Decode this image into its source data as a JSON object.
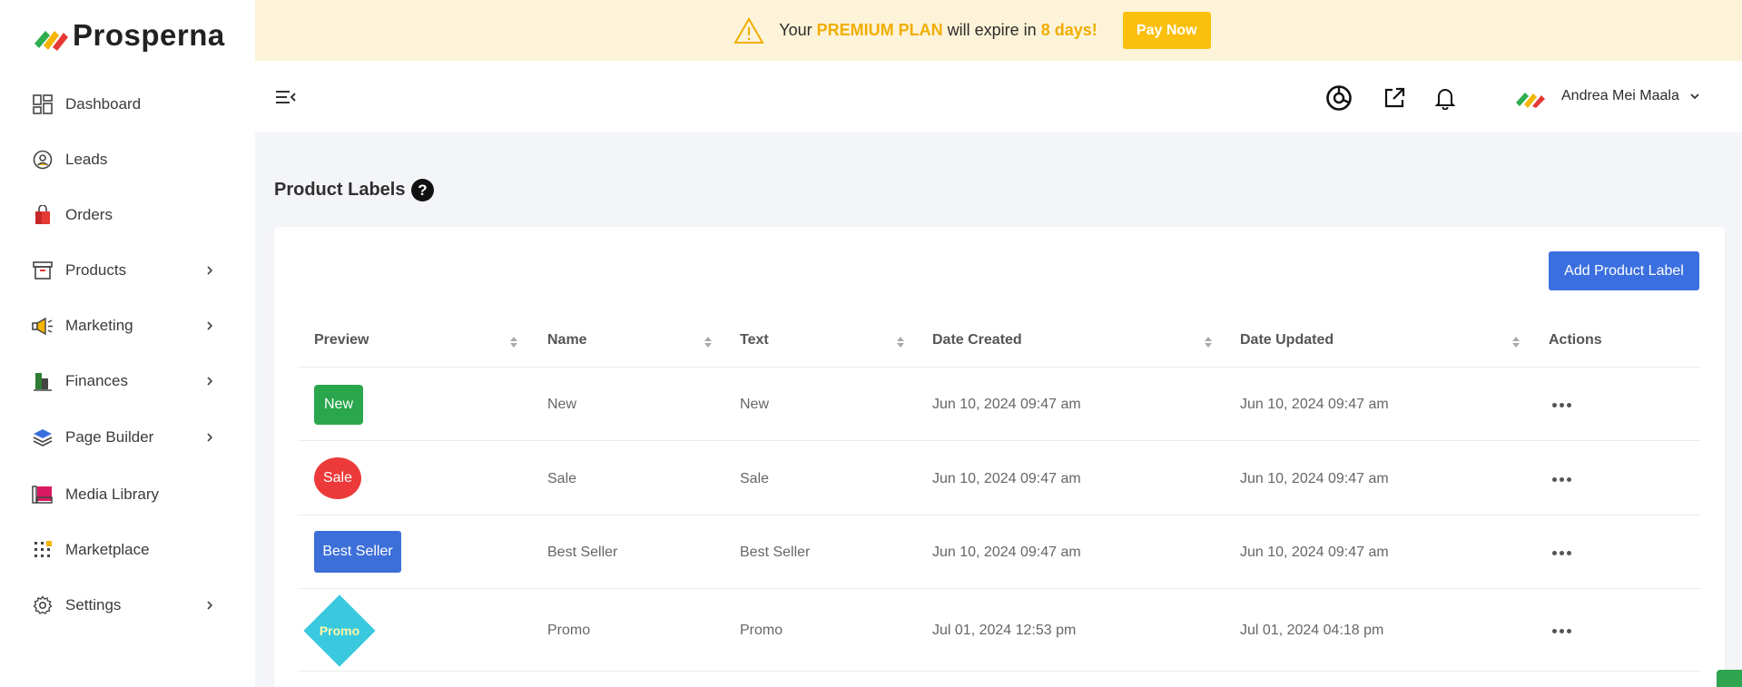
{
  "app": {
    "logo_text": "Prosperna"
  },
  "sidebar": {
    "items": [
      {
        "label": "Dashboard",
        "icon": "dashboard-icon",
        "has_children": false
      },
      {
        "label": "Leads",
        "icon": "leads-icon",
        "has_children": false
      },
      {
        "label": "Orders",
        "icon": "orders-icon",
        "has_children": false
      },
      {
        "label": "Products",
        "icon": "products-icon",
        "has_children": true
      },
      {
        "label": "Marketing",
        "icon": "megaphone-icon",
        "has_children": true
      },
      {
        "label": "Finances",
        "icon": "finances-icon",
        "has_children": true
      },
      {
        "label": "Page Builder",
        "icon": "layers-icon",
        "has_children": true
      },
      {
        "label": "Media Library",
        "icon": "media-icon",
        "has_children": false
      },
      {
        "label": "Marketplace",
        "icon": "marketplace-icon",
        "has_children": false
      },
      {
        "label": "Settings",
        "icon": "gear-icon",
        "has_children": true
      }
    ]
  },
  "banner": {
    "prefix": "Your",
    "plan": "PREMIUM PLAN",
    "middle": "will expire in",
    "days": "8 days!",
    "button": "Pay Now"
  },
  "topbar": {
    "user_name": "Andrea Mei Maala"
  },
  "page": {
    "title": "Product Labels",
    "help": "?",
    "add_button": "Add Product Label"
  },
  "table": {
    "headers": [
      "Preview",
      "Name",
      "Text",
      "Date Created",
      "Date Updated",
      "Actions"
    ],
    "rows": [
      {
        "preview": "New",
        "name": "New",
        "text": "New",
        "created": "Jun 10, 2024 09:47 am",
        "updated": "Jun 10, 2024 09:47 am"
      },
      {
        "preview": "Sale",
        "name": "Sale",
        "text": "Sale",
        "created": "Jun 10, 2024 09:47 am",
        "updated": "Jun 10, 2024 09:47 am"
      },
      {
        "preview": "Best Seller",
        "name": "Best Seller",
        "text": "Best Seller",
        "created": "Jun 10, 2024 09:47 am",
        "updated": "Jun 10, 2024 09:47 am"
      },
      {
        "preview": "Promo",
        "name": "Promo",
        "text": "Promo",
        "created": "Jul 01, 2024 12:53 pm",
        "updated": "Jul 01, 2024 04:18 pm"
      }
    ]
  },
  "colors": {
    "accent": "#3b6fe0",
    "banner_bg": "#fdf3d8",
    "banner_highlight": "#f0ae00",
    "pay_button": "#fbbf0d",
    "label_new": "#2aa74d",
    "label_sale": "#ec3a3a",
    "label_best_seller": "#3d6fd8",
    "label_promo": "#39c9df"
  }
}
